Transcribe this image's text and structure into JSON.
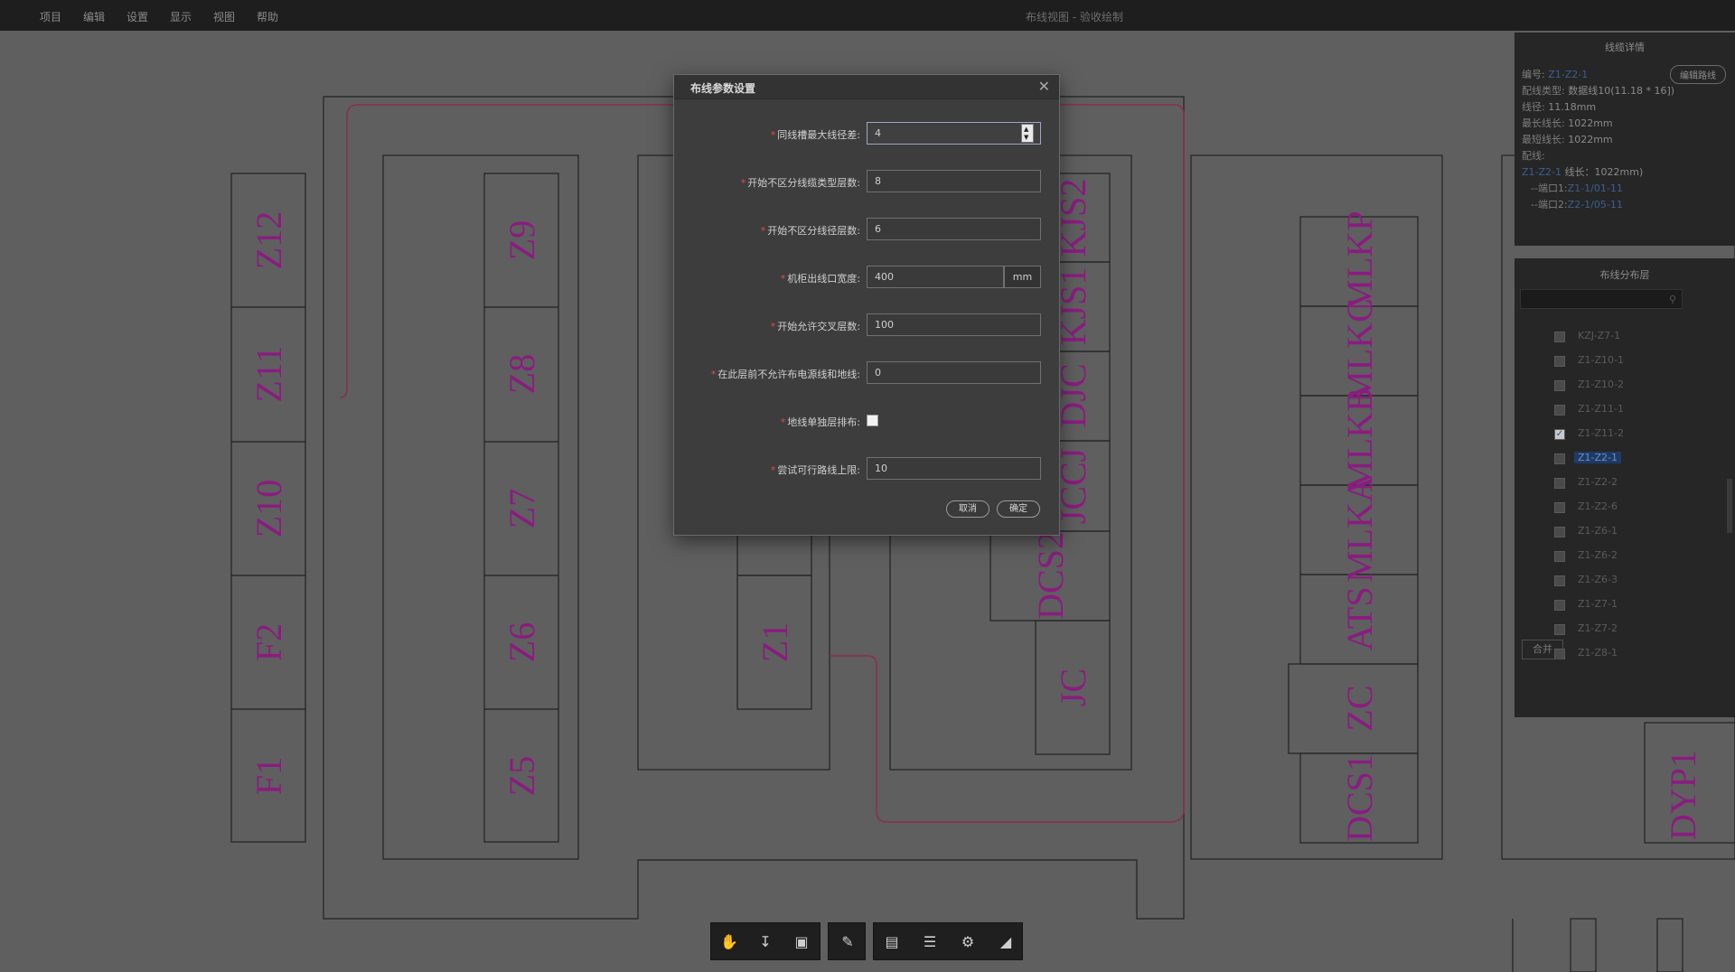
{
  "menu": [
    "项目",
    "编辑",
    "设置",
    "显示",
    "视图",
    "帮助"
  ],
  "window_title": "布线视图 - 验收绘制",
  "cabinets": [
    "Z12",
    "Z11",
    "Z10",
    "F2",
    "F1",
    "Z9",
    "Z8",
    "Z7",
    "Z6",
    "Z5",
    "Z1",
    "KJS2",
    "KJS1",
    "DJC",
    "JCCJ",
    "DCS2",
    "JC",
    "MLKP",
    "MLKC",
    "MLKB",
    "MLKA",
    "ATS",
    "ZC",
    "DCS1",
    "DYP1"
  ],
  "details_panel": {
    "title": "线缆详情",
    "edit_button": "编辑路线",
    "fields": [
      {
        "key": "编号:",
        "value": "Z1-Z2-1"
      },
      {
        "key": "配线类型:",
        "value": "数据线10(11.18 * 16])"
      },
      {
        "key": "线径:",
        "value": "11.18mm"
      },
      {
        "key": "最长线长:",
        "value": "1022mm"
      },
      {
        "key": "最短线长:",
        "value": "1022mm"
      },
      {
        "key": "配线:",
        "value": ""
      }
    ],
    "route": "Z1-Z2-1",
    "route_length": "线长：1022mm)",
    "port1_label": "--端口1:",
    "port1_value": "Z1-1/01-11",
    "port2_label": "--端口2:",
    "port2_value": "Z2-1/05-11"
  },
  "layer_panel": {
    "title": "布线分布层",
    "search_placeholder": "",
    "items": [
      {
        "label": "KZJ-Z7-1",
        "checked": false,
        "selected": false
      },
      {
        "label": "Z1-Z10-1",
        "checked": false,
        "selected": false
      },
      {
        "label": "Z1-Z10-2",
        "checked": false,
        "selected": false
      },
      {
        "label": "Z1-Z11-1",
        "checked": false,
        "selected": false
      },
      {
        "label": "Z1-Z11-2",
        "checked": true,
        "selected": false
      },
      {
        "label": "Z1-Z2-1",
        "checked": false,
        "selected": true
      },
      {
        "label": "Z1-Z2-2",
        "checked": false,
        "selected": false
      },
      {
        "label": "Z1-Z2-6",
        "checked": false,
        "selected": false
      },
      {
        "label": "Z1-Z6-1",
        "checked": false,
        "selected": false
      },
      {
        "label": "Z1-Z6-2",
        "checked": false,
        "selected": false
      },
      {
        "label": "Z1-Z6-3",
        "checked": false,
        "selected": false
      },
      {
        "label": "Z1-Z7-1",
        "checked": false,
        "selected": false
      },
      {
        "label": "Z1-Z7-2",
        "checked": false,
        "selected": false
      },
      {
        "label": "Z1-Z8-1",
        "checked": false,
        "selected": false
      }
    ],
    "merge_button": "合并"
  },
  "dialog": {
    "title": "布线参数设置",
    "fields": [
      {
        "label": "同线槽最大线径差:",
        "value": "4"
      },
      {
        "label": "开始不区分线缆类型层数:",
        "value": "8"
      },
      {
        "label": "开始不区分线径层数:",
        "value": "6"
      },
      {
        "label": "机柜出线口宽度:",
        "value": "400",
        "unit": "mm"
      },
      {
        "label": "开始允许交叉层数:",
        "value": "100"
      },
      {
        "label": "在此层前不允许布电源线和地线:",
        "value": "0"
      },
      {
        "label": "地线单独层排布:",
        "checked": false
      },
      {
        "label": "尝试可行路线上限:",
        "value": "10"
      }
    ],
    "cancel": "取消",
    "confirm": "确定"
  },
  "toolbar": [
    {
      "icon": "hand-icon",
      "active": true
    },
    {
      "icon": "anchor-icon",
      "active": false
    },
    {
      "icon": "camera-icon",
      "active": false
    },
    {
      "icon": "pencil-icon",
      "active": false
    },
    {
      "icon": "save-icon",
      "active": false
    },
    {
      "icon": "layers-icon",
      "active": false
    },
    {
      "icon": "gear-icon",
      "active": false
    },
    {
      "icon": "fit-view-icon",
      "active": false
    }
  ]
}
